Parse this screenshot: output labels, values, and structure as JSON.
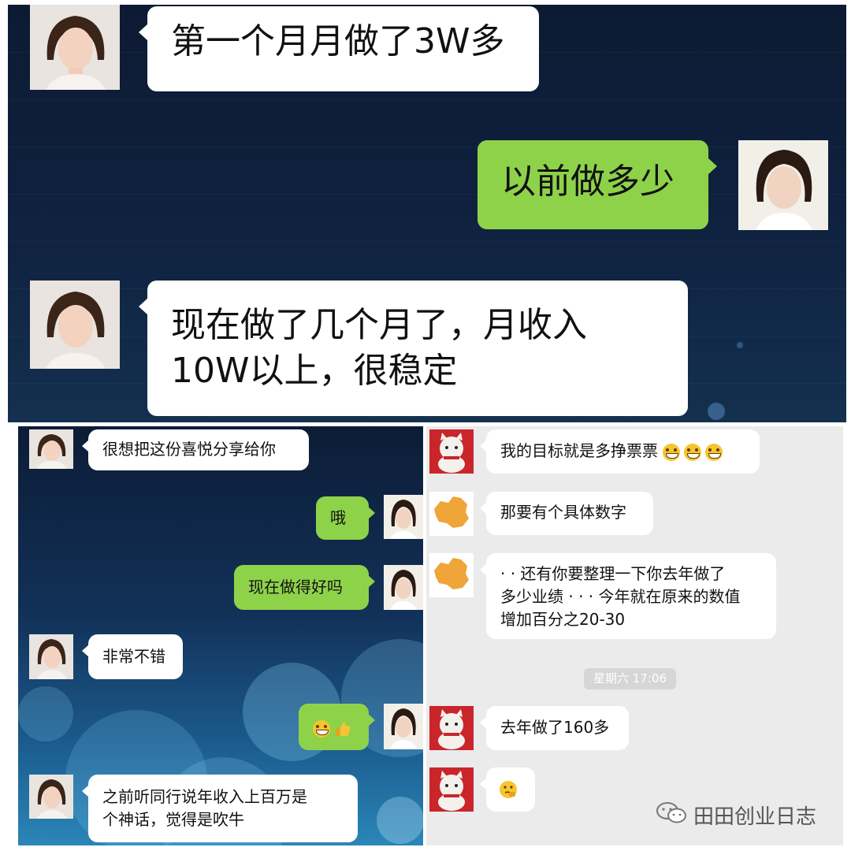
{
  "top_chat": {
    "messages": [
      {
        "side": "left",
        "text": "第一个月月做了3W多"
      },
      {
        "side": "right",
        "text": "以前做多少"
      },
      {
        "side": "left",
        "line1": "现在做了几个月了，月收入",
        "line2": "10W以上，很稳定"
      }
    ]
  },
  "left_chat": {
    "messages": [
      {
        "side": "left",
        "text": "很想把这份喜悦分享给你"
      },
      {
        "side": "right",
        "text": "哦"
      },
      {
        "side": "right",
        "text": "现在做得好吗"
      },
      {
        "side": "left",
        "text": "非常不错"
      },
      {
        "side": "right",
        "emoji": [
          "grin-emoji",
          "thumbs-up-emoji"
        ]
      },
      {
        "side": "left",
        "line1": "之前听同行说年收入上百万是",
        "line2": "个神话，觉得是吹牛"
      }
    ]
  },
  "right_chat": {
    "messages": [
      {
        "side": "left",
        "text": "我的目标就是多挣票票",
        "emoji": [
          "grin-emoji",
          "grin-emoji",
          "grin-emoji"
        ]
      },
      {
        "side": "left",
        "text": "那要有个具体数字"
      },
      {
        "side": "left",
        "line1": "· · 还有你要整理一下你去年做了",
        "line2": "多少业绩 · · · 今年就在原来的数值",
        "line3": "增加百分之20-30"
      },
      {
        "side": "left",
        "text": "去年做了160多"
      },
      {
        "side": "left",
        "emoji": [
          "thinking-emoji"
        ]
      }
    ],
    "timestamp": "星期六 17:06"
  },
  "watermark": {
    "text": "田田创业日志",
    "icon": "wechat-icon"
  },
  "colors": {
    "green_bubble": "#8ed24a",
    "white_bubble": "#ffffff",
    "dark_bg": "#0f2240",
    "light_bg": "#ebebeb"
  }
}
